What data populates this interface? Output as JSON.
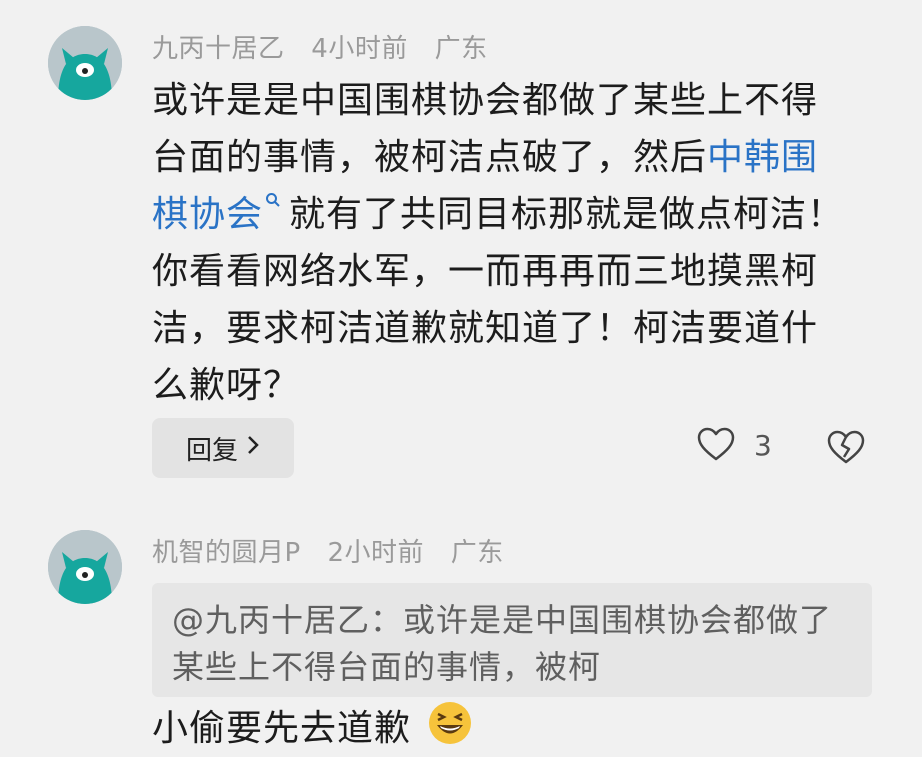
{
  "comments": [
    {
      "author": "九丙十居乙",
      "time": "4小时前",
      "location": "广东",
      "text_before_link": "或许是是中国围棋协会都做了某些上不得台面的事情，被柯洁点破了，然后",
      "link_text": "中韩围棋协会",
      "text_after_link": "就有了共同目标那就是做点柯洁！你看看网络水军，一而再再而三地摸黑柯洁，要求柯洁道歉就知道了！柯洁要道什么歉呀？",
      "reply_label": "回复",
      "likes": "3"
    },
    {
      "author": "机智的圆月P",
      "time": "2小时前",
      "location": "广东",
      "quote": "@九丙十居乙：或许是是中国围棋协会都做了某些上不得台面的事情，被柯",
      "text": "小偷要先去道歉"
    }
  ],
  "icons": {
    "search": "search-icon",
    "reply_chevron": "chevron-right-icon",
    "like": "heart-outline-icon",
    "dislike": "broken-heart-icon",
    "emoji": "grinning-squint-emoji"
  },
  "colors": {
    "link": "#2a73c6",
    "avatar": "#16a79e"
  }
}
